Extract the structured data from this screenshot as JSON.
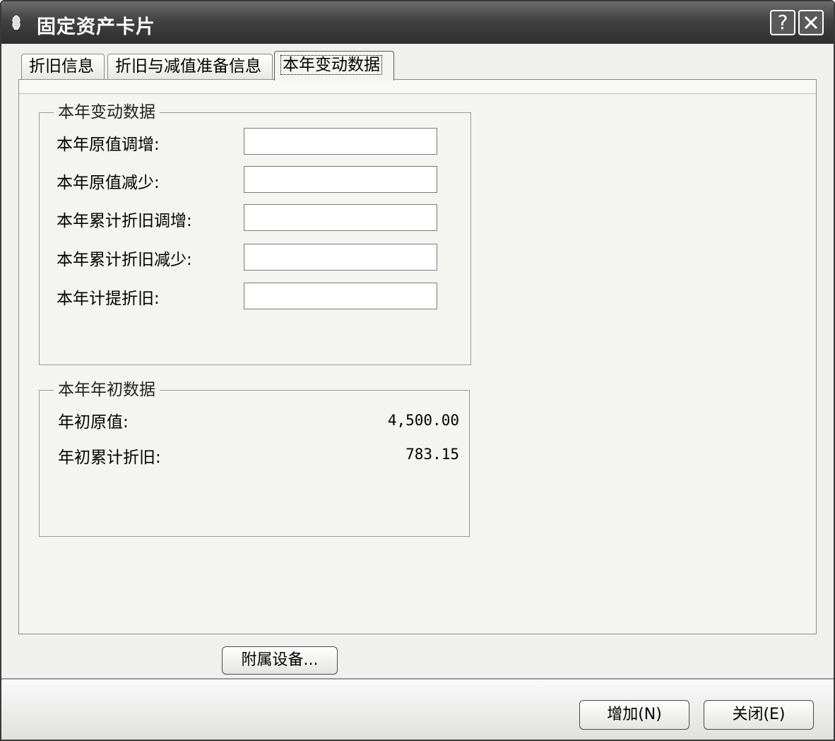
{
  "window": {
    "title": "固定资产卡片",
    "help_label": "?",
    "close_label": "✕"
  },
  "tabs": [
    {
      "label": "折旧信息",
      "active": false
    },
    {
      "label": "折旧与减值准备信息",
      "active": false
    },
    {
      "label": "本年变动数据",
      "active": true
    }
  ],
  "change_group": {
    "title": "本年变动数据",
    "fields": [
      {
        "label": "本年原值调增:",
        "value": ""
      },
      {
        "label": "本年原值减少:",
        "value": ""
      },
      {
        "label": "本年累计折旧调增:",
        "value": ""
      },
      {
        "label": "本年累计折旧减少:",
        "value": ""
      },
      {
        "label": "本年计提折旧:",
        "value": ""
      }
    ]
  },
  "opening_group": {
    "title": "本年年初数据",
    "rows": [
      {
        "label": "年初原值:",
        "value": "4,500.00"
      },
      {
        "label": "年初累计折旧:",
        "value": "783.15"
      }
    ]
  },
  "buttons": {
    "accessory": "附属设备...",
    "add": "增加(N)",
    "close": "关闭(E)"
  }
}
